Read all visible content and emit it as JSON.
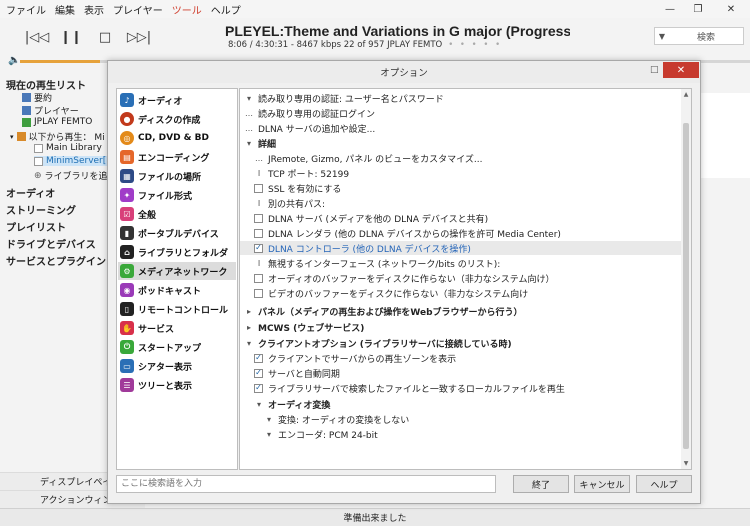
{
  "menu": [
    "ファイル",
    "編集",
    "表示",
    "プレイヤー",
    "ツール",
    "ヘルプ"
  ],
  "window_controls": {
    "minimize": "—",
    "restore": "❐",
    "close": "✕"
  },
  "now_playing": {
    "title": "PLEYEL:Theme and Variations in G major (Progressive ...",
    "status": "8:06 / 4:30:31 - 8467 kbps   22 of 957   JPLAY FEMTO",
    "dots": "• • • • •"
  },
  "search": {
    "label": "検索"
  },
  "tree": {
    "header": "現在の再生リスト",
    "items": [
      "要約",
      "プレイヤー",
      "JPLAY FEMTO",
      "以下から再生： Mi",
      "Main Library",
      "MinimServer[",
      "ライブラリを追加..."
    ],
    "sections": [
      "オーディオ",
      "ストリーミング",
      "プレイリスト",
      "ドライブとデバイス",
      "サービスとプラグイン"
    ]
  },
  "left_bottom": [
    "ディスプレイペイン",
    "アクションウィンドウ"
  ],
  "status_bar": "準備出来ました",
  "dialog": {
    "title": "オプション",
    "close": "✕",
    "categories": [
      "オーディオ",
      "ディスクの作成",
      "CD, DVD & BD",
      "エンコーディング",
      "ファイルの場所",
      "ファイル形式",
      "全般",
      "ポータブルデバイス",
      "ライブラリとフォルダ",
      "メディアネットワーク",
      "ポッドキャスト",
      "リモートコントロール",
      "サービス",
      "スタートアップ",
      "シアター表示",
      "ツリーと表示"
    ],
    "rows": [
      {
        "pre": "▾",
        "text": "読み取り専用の認証: ユーザー名とパスワード"
      },
      {
        "pre": "…",
        "text": "読み取り専用の認証ログイン"
      },
      {
        "pre": "…",
        "text": "DLNA サーバの追加や設定..."
      },
      {
        "pre": "▾",
        "text": "詳細"
      },
      {
        "pre": "…",
        "text": "JRemote, Gizmo, パネル のビューをカスタマイズ..."
      },
      {
        "pre": "I",
        "text": "TCP ポート: 52199"
      },
      {
        "cb": false,
        "text": "SSL を有効にする"
      },
      {
        "pre": "I",
        "text": "別の共有パス:"
      },
      {
        "cb": false,
        "text": "DLNA サーバ (メディアを他の DLNA デバイスと共有)"
      },
      {
        "cb": false,
        "text": "DLNA レンダラ (他の DLNA デバイスからの操作を許可 Media Center)"
      },
      {
        "cb": true,
        "text": "DLNA コントローラ (他の DLNA デバイスを操作)"
      },
      {
        "pre": "I",
        "text": "無視するインターフェース (ネットワーク/bits のリスト):"
      },
      {
        "cb": false,
        "text": "オーディオのバッファーをディスクに作らない（非力なシステム向け）"
      },
      {
        "cb": false,
        "text": "ビデオのバッファーをディスクに作らない（非力なシステム向け"
      },
      {
        "pre": "▸",
        "text": "パネル（メディアの再生および操作をWebブラウザーから行う）"
      },
      {
        "pre": "▸",
        "text": "MCWS (ウェブサービス)"
      },
      {
        "pre": "▾",
        "text": "クライアントオプション (ライブラリサーバに接続している時)"
      },
      {
        "cb": true,
        "text": "クライアントでサーバからの再生ゾーンを表示"
      },
      {
        "cb": true,
        "text": "サーバと自動同期"
      },
      {
        "cb": true,
        "text": "ライブラリサーバで検索したファイルと一致するローカルファイルを再生"
      },
      {
        "pre": "▾",
        "text": "オーディオ変換"
      },
      {
        "pre": "▾",
        "text": "変換: オーディオの変換をしない"
      },
      {
        "pre": "▾",
        "text": "エンコーダ: PCM 24-bit"
      }
    ],
    "search_placeholder": "ここに検索語を入力",
    "buttons": {
      "ok": "終了",
      "cancel": "キャンセル",
      "help": "ヘルプ"
    }
  }
}
